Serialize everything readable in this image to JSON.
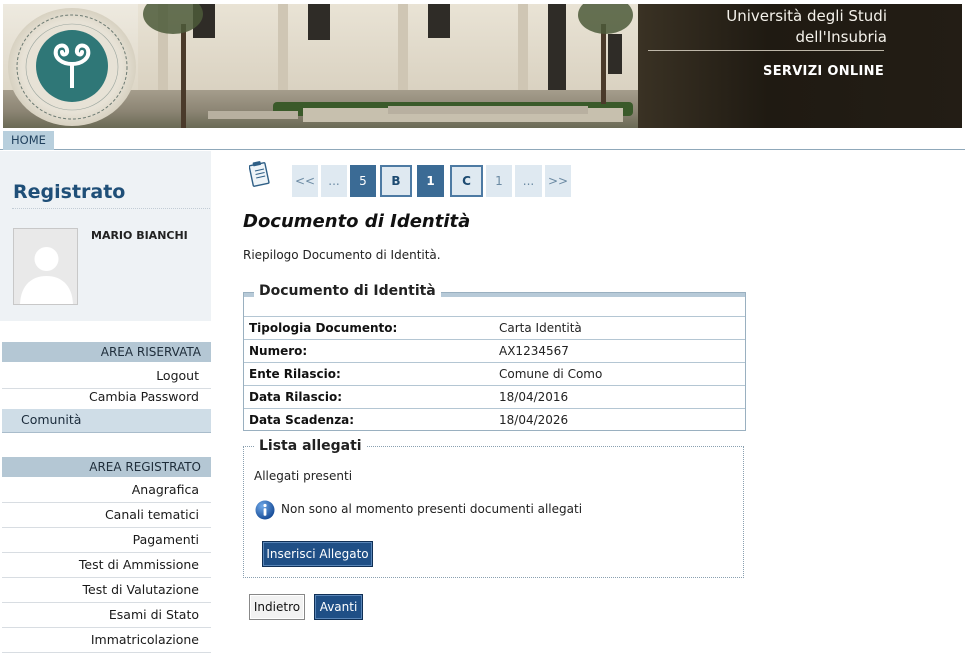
{
  "header": {
    "university_line1": "Università degli Studi",
    "university_line2": "dell'Insubria",
    "services": "SERVIZI ONLINE",
    "logo_name": "insubria-logo"
  },
  "topnav": {
    "home": "HOME"
  },
  "sidebar": {
    "title": "Registrato",
    "user_name": "MARIO BIANCHI",
    "area_riservata": {
      "heading": "AREA RISERVATA",
      "items": [
        "Logout",
        "Cambia Password"
      ]
    },
    "comunita": "Comunità",
    "area_registrato": {
      "heading": "AREA REGISTRATO",
      "items": [
        "Anagrafica",
        "Canali tematici",
        "Pagamenti",
        "Test di Ammissione",
        "Test di Valutazione",
        "Esami di Stato",
        "Immatricolazione"
      ]
    }
  },
  "pager": {
    "items": [
      "<<",
      "...",
      "5",
      "B",
      "1",
      "C",
      "1",
      "...",
      ">>"
    ]
  },
  "main": {
    "title": "Documento di Identità",
    "description": "Riepilogo Documento di Identità.",
    "doc_section": {
      "legend": "Documento di Identità",
      "rows": [
        {
          "label": "Tipologia Documento:",
          "value": "Carta Identità"
        },
        {
          "label": "Numero:",
          "value": "AX1234567"
        },
        {
          "label": "Ente Rilascio:",
          "value": "Comune di Como"
        },
        {
          "label": "Data Rilascio:",
          "value": "18/04/2016"
        },
        {
          "label": "Data Scadenza:",
          "value": "18/04/2026"
        }
      ]
    },
    "attachments": {
      "legend": "Lista allegati",
      "subtitle": "Allegati presenti",
      "empty_message": "Non sono al momento presenti documenti allegati",
      "add_button": "Inserisci Allegato"
    },
    "back_button": "Indietro",
    "next_button": "Avanti"
  },
  "colors": {
    "brand_blue": "#1f4f86",
    "sidebar_heading": "#b4c7d4",
    "title_blue": "#1f4f78"
  }
}
